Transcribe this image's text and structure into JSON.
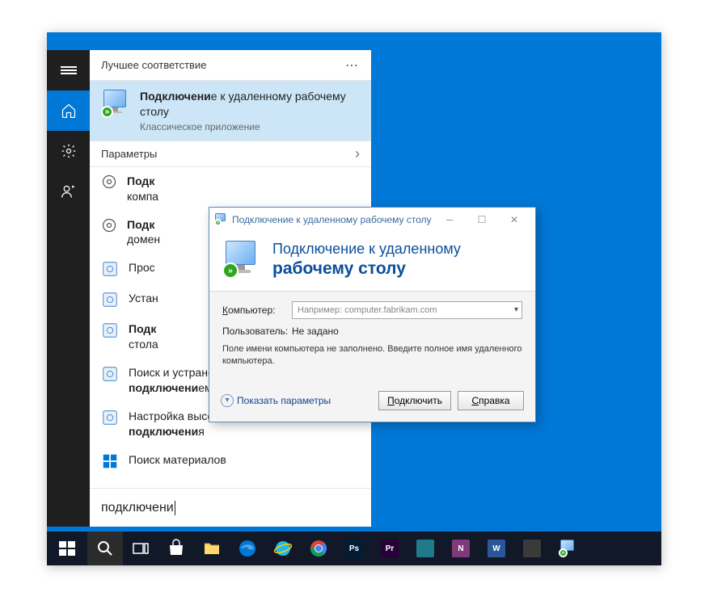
{
  "rail": {
    "items": [
      "menu",
      "home",
      "settings",
      "people"
    ]
  },
  "results": {
    "header": "Лучшее соответствие",
    "best": {
      "title_prefix": "Подключени",
      "title_rest": "е к удаленному рабочему столу",
      "subtitle": "Классическое приложение"
    },
    "section_params": "Параметры",
    "items": [
      {
        "prefix": "Подк",
        "rest": " компа",
        "trunc": true
      },
      {
        "prefix": "Подк",
        "rest": " домен",
        "trunc": true
      },
      {
        "prefix": "",
        "rest": "Прос",
        "trunc": true
      },
      {
        "prefix": "",
        "rest": "Устан",
        "trunc": true
      },
      {
        "prefix": "Подк",
        "rest": " стола",
        "trunc": true
      },
      {
        "prefix": "",
        "rest": "Поиск и устранение проблем с сетью и ",
        "suffix": "подключени",
        "tail": "ем"
      },
      {
        "prefix": "",
        "rest": "Настройка высокоскоростного ",
        "suffix": "подключени",
        "tail": "я"
      }
    ],
    "store_item": "Поиск материалов",
    "search_value": "подключени"
  },
  "rdp": {
    "title": "Подключение к удаленному рабочему столу",
    "banner_line1": "Подключение к удаленному",
    "banner_line2": "рабочему столу",
    "label_computer": "Компьютер:",
    "computer_placeholder": "Например: computer.fabrikam.com",
    "label_user": "Пользователь:",
    "user_value": "Не задано",
    "info": "Поле имени компьютера не заполнено. Введите полное имя удаленного компьютера.",
    "show_params": "Показать параметры",
    "btn_connect": "Подключить",
    "btn_help": "Справка"
  },
  "taskbar": {
    "apps": [
      {
        "name": "start"
      },
      {
        "name": "search"
      },
      {
        "name": "taskview"
      },
      {
        "name": "store"
      },
      {
        "name": "explorer"
      },
      {
        "name": "edge"
      },
      {
        "name": "ie"
      },
      {
        "name": "chrome"
      },
      {
        "name": "photoshop",
        "bg": "#001d36",
        "txt": "Ps"
      },
      {
        "name": "premiere",
        "bg": "#2a003a",
        "txt": "Pr"
      },
      {
        "name": "app1",
        "bg": "#1f7a8c",
        "txt": ""
      },
      {
        "name": "onenote",
        "bg": "#80397b",
        "txt": "N"
      },
      {
        "name": "word",
        "bg": "#2b579a",
        "txt": "W"
      },
      {
        "name": "app2",
        "bg": "#333",
        "txt": ""
      },
      {
        "name": "rdp-task"
      }
    ]
  }
}
